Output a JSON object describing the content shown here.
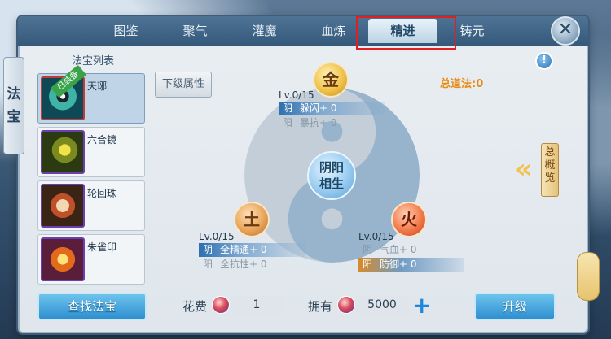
{
  "tabs": [
    {
      "label": "图鉴"
    },
    {
      "label": "聚气"
    },
    {
      "label": "灌魔"
    },
    {
      "label": "血炼"
    },
    {
      "label": "精进",
      "active": true
    },
    {
      "label": "铸元"
    }
  ],
  "close_label": "✕",
  "side_label": [
    "法",
    "宝"
  ],
  "list": {
    "title": "法宝列表",
    "items": [
      {
        "name": "天琊",
        "badge": "已装备",
        "selected": true
      },
      {
        "name": "六合镜"
      },
      {
        "name": "轮回珠"
      },
      {
        "name": "朱雀印"
      }
    ]
  },
  "sub_attr_button": "下级属性",
  "total_dao": "总道法:0",
  "info_icon": "!",
  "overview_label": "总概览",
  "center": {
    "line1": "阴阳",
    "line2": "相生"
  },
  "nodes": {
    "gold": {
      "label": "金",
      "level": "Lv.0/15",
      "yin_tag": "阴",
      "yin_attr": "躲闪+ 0",
      "yang_tag": "阳",
      "yang_attr": "暴抗+ 0"
    },
    "earth": {
      "label": "土",
      "level": "Lv.0/15",
      "yin_tag": "阴",
      "yin_attr": "全精通+ 0",
      "yang_tag": "阳",
      "yang_attr": "全抗性+ 0"
    },
    "fire": {
      "label": "火",
      "level": "Lv.0/15",
      "yin_tag": "阴",
      "yin_attr": "气血+ 0",
      "yang_tag": "阳",
      "yang_attr": "防御+ 0"
    }
  },
  "bottom": {
    "find_button": "查找法宝",
    "cost_label": "花费",
    "cost_value": "1",
    "own_label": "拥有",
    "own_value": "5000",
    "upgrade_button": "升级"
  }
}
